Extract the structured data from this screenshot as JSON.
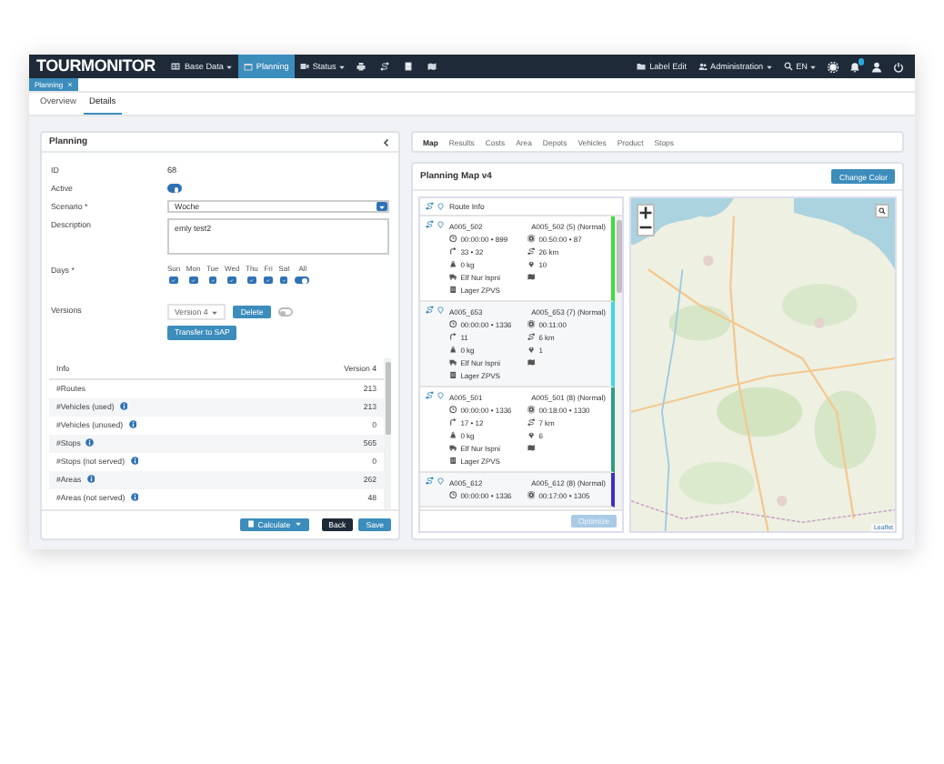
{
  "nav": {
    "logo": "TOURMONITOR",
    "menu": [
      {
        "label": "Base Data",
        "dropdown": true,
        "selected": false
      },
      {
        "label": "Planning",
        "dropdown": false,
        "selected": true
      },
      {
        "label": "Status",
        "dropdown": true,
        "selected": false
      }
    ],
    "right": [
      {
        "label": "Label Edit",
        "dropdown": false
      },
      {
        "label": "Administration",
        "dropdown": true
      },
      {
        "label": "EN",
        "dropdown": true
      }
    ]
  },
  "open_tabs": [
    {
      "label": "Planning",
      "selected": true
    }
  ],
  "subnav": [
    {
      "label": "Overview",
      "selected": false
    },
    {
      "label": "Details",
      "selected": true
    }
  ],
  "planning": {
    "title": "Planning",
    "id_label": "ID",
    "id": "68",
    "active_label": "Active",
    "active": true,
    "scenario_label": "Scenario *",
    "scenario": "Woche",
    "description_label": "Description",
    "description": "emly test2",
    "days_label": "Days *",
    "days": [
      {
        "label": "Sun",
        "checked": true
      },
      {
        "label": "Mon",
        "checked": true
      },
      {
        "label": "Tue",
        "checked": true
      },
      {
        "label": "Wed",
        "checked": true
      },
      {
        "label": "Thu",
        "checked": true
      },
      {
        "label": "Fri",
        "checked": true
      },
      {
        "label": "Sat",
        "checked": true
      }
    ],
    "all": {
      "label": "All",
      "on": true
    },
    "versions_label": "Versions",
    "version": "Version 4",
    "delete": "Delete",
    "version_toggle": false,
    "transfer": "Transfer to SAP",
    "table": {
      "columns": [
        "Info",
        "Version 4"
      ],
      "rows": [
        {
          "label": "#Routes",
          "value": "213",
          "info": false
        },
        {
          "label": "#Vehicles (used)",
          "value": "213",
          "info": true
        },
        {
          "label": "#Vehicles (unused)",
          "value": "0",
          "info": true
        },
        {
          "label": "#Stops",
          "value": "565",
          "info": true
        },
        {
          "label": "#Stops (not served)",
          "value": "0",
          "info": true
        },
        {
          "label": "#Areas",
          "value": "262",
          "info": true
        },
        {
          "label": "#Areas (not served)",
          "value": "48",
          "info": true
        }
      ]
    },
    "buttons": {
      "calculate": "Calculate",
      "back": "Back",
      "save": "Save"
    }
  },
  "tabs": [
    {
      "label": "Map",
      "selected": true
    },
    {
      "label": "Results",
      "selected": false
    },
    {
      "label": "Costs",
      "selected": false
    },
    {
      "label": "Area",
      "selected": false
    },
    {
      "label": "Depots",
      "selected": false
    },
    {
      "label": "Vehicles",
      "selected": false
    },
    {
      "label": "Product",
      "selected": false
    },
    {
      "label": "Stops",
      "selected": false
    }
  ],
  "map_card": {
    "title": "Planning Map v4",
    "button": "Change Color",
    "route_header": "Route Info",
    "routes": [
      {
        "name": "A005_502",
        "label": "A005_502 (5) (Normal)",
        "color": "#3ddc3d",
        "time": "00:00:00 • 899",
        "duration": "00:50:00 • 87",
        "stops": "33 • 32",
        "distance": "26 km",
        "weight": "0 kg",
        "count": "10",
        "vehicle": "Elf Nur Ispni",
        "depot": "Lager ZPVS"
      },
      {
        "name": "A005_653",
        "label": "A005_653 (7) (Normal)",
        "color": "#3fd6e8",
        "time": "00:00:00 • 1336",
        "duration": "00:11:00",
        "stops": "11",
        "distance": "6 km",
        "weight": "0 kg",
        "count": "1",
        "vehicle": "Elf Nur Ispni",
        "depot": "Lager ZPVS"
      },
      {
        "name": "A005_501",
        "label": "A005_501 (8) (Normal)",
        "color": "#2f9e7e",
        "time": "00:00:00 • 1336",
        "duration": "00:18:00 • 1330",
        "stops": "17 • 12",
        "distance": "7 km",
        "weight": "0 kg",
        "count": "6",
        "vehicle": "Elf Nur Ispni",
        "depot": "Lager ZPVS"
      },
      {
        "name": "A005_612",
        "label": "A005_612 (8) (Normal)",
        "color": "#3b2fc9",
        "time": "00:00:00 • 1336",
        "duration": "00:17:00 • 1305"
      }
    ],
    "optimize": {
      "label": "Optimize",
      "disabled": true
    },
    "attribution": "Leaflet"
  }
}
